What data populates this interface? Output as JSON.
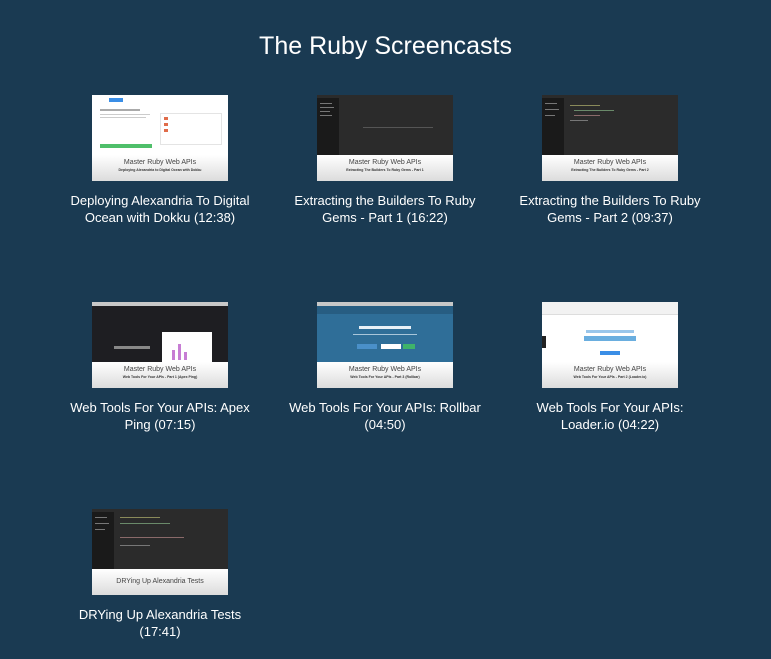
{
  "page": {
    "title": "The Ruby Screencasts"
  },
  "thumb_caption": "Master Ruby Web APIs",
  "screencasts": [
    {
      "title": "Deploying Alexandria To Digital Ocean with Dokku (12:38)",
      "thumb_subtitle": "Deploying Alexandria to Digital Ocean with Dokku",
      "screen": "light"
    },
    {
      "title": "Extracting the Builders To Ruby Gems - Part 1 (16:22)",
      "thumb_subtitle": "Extracting The Builders To Ruby Gems - Part 1",
      "screen": "editor"
    },
    {
      "title": "Extracting the Builders To Ruby Gems - Part 2 (09:37)",
      "thumb_subtitle": "Extracting The Builders To Ruby Gems - Part 2",
      "screen": "editor"
    },
    {
      "title": "Web Tools For Your APIs: Apex Ping (07:15)",
      "thumb_subtitle": "Web Tools For Your APIs - Part 1 (Apex Ping)",
      "screen": "dark"
    },
    {
      "title": "Web Tools For Your APIs: Rollbar (04:50)",
      "thumb_subtitle": "Web Tools For Your APIs - Part 3 (Rollbar)",
      "screen": "blue"
    },
    {
      "title": "Web Tools For Your APIs: Loader.io (04:22)",
      "thumb_subtitle": "Web Tools For Your APIs - Part 2 (Loader.io)",
      "screen": "light"
    },
    {
      "title": "DRYing Up Alexandria Tests (17:41)",
      "thumb_caption": "DRYing Up Alexandria Tests",
      "screen": "editor"
    }
  ],
  "colors": {
    "background": "#1a3a52",
    "text": "#ffffff"
  }
}
